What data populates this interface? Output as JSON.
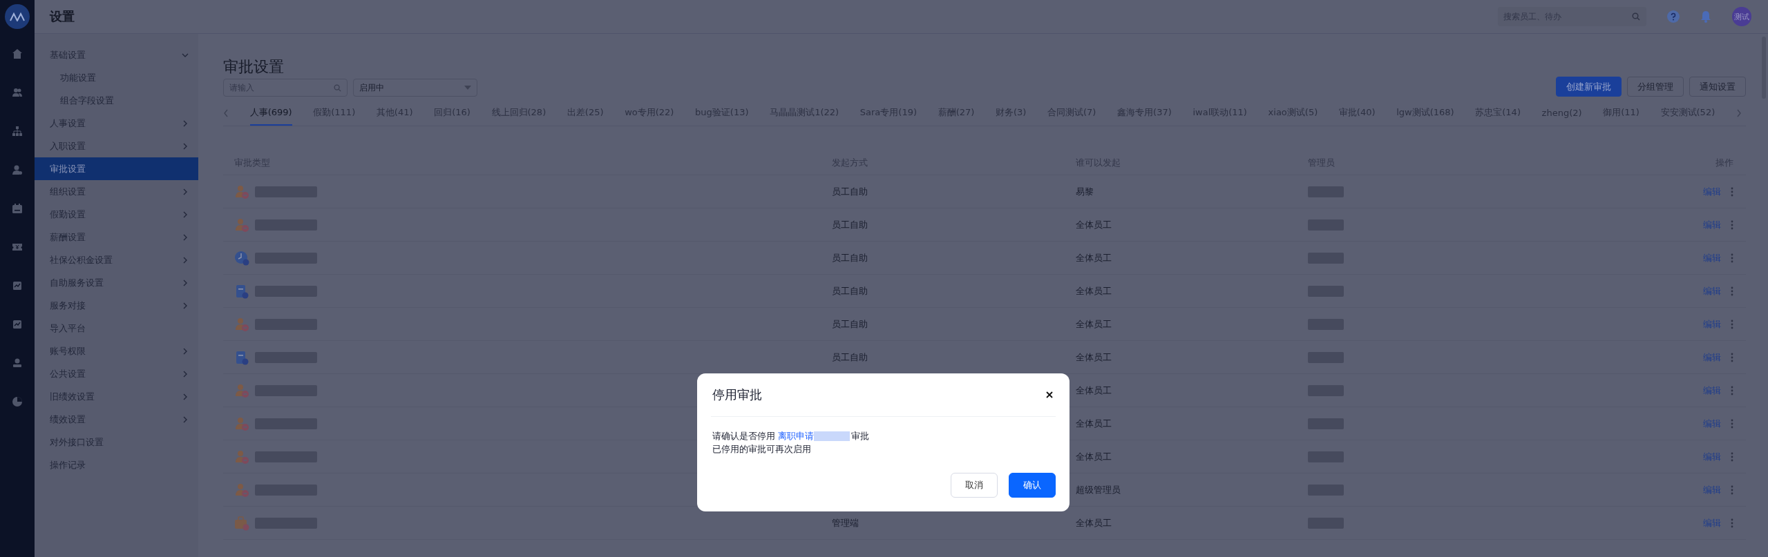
{
  "app": {
    "title": "设置"
  },
  "top_bar": {
    "search": {
      "placeholder": "搜索员工、待办"
    },
    "avatar": "测试"
  },
  "sidebar": {
    "items": [
      {
        "label": "基础设置",
        "expanded": true,
        "selected": false,
        "children": [
          {
            "label": "功能设置",
            "selected": false
          },
          {
            "label": "组合字段设置",
            "selected": false
          }
        ]
      },
      {
        "label": "人事设置",
        "expanded": false,
        "selected": false
      },
      {
        "label": "入职设置",
        "expanded": false,
        "selected": false
      },
      {
        "label": "审批设置",
        "selected": true
      },
      {
        "label": "组织设置",
        "expanded": false,
        "selected": false
      },
      {
        "label": "假勤设置",
        "expanded": false,
        "selected": false
      },
      {
        "label": "薪酬设置",
        "expanded": false,
        "selected": false
      },
      {
        "label": "社保公积金设置",
        "expanded": false,
        "selected": false
      },
      {
        "label": "自助服务设置",
        "expanded": false,
        "selected": false
      },
      {
        "label": "服务对接",
        "expanded": false,
        "selected": false
      },
      {
        "label": "导入平台",
        "selected": false
      },
      {
        "label": "账号权限",
        "expanded": false,
        "selected": false
      },
      {
        "label": "公共设置",
        "expanded": false,
        "selected": false
      },
      {
        "label": "旧绩效设置",
        "expanded": false,
        "selected": false
      },
      {
        "label": "绩效设置",
        "expanded": false,
        "selected": false
      },
      {
        "label": "对外接口设置",
        "selected": false
      },
      {
        "label": "操作记录",
        "selected": false
      }
    ]
  },
  "page": {
    "title": "审批设置",
    "search": {
      "placeholder": "请输入"
    },
    "status_select": {
      "value": "启用中"
    },
    "buttons": [
      {
        "label": "创建新审批",
        "kind": "primary"
      },
      {
        "label": "分组管理",
        "kind": "default"
      },
      {
        "label": "通知设置",
        "kind": "default"
      }
    ]
  },
  "tabs": [
    {
      "label": "人事(699)",
      "selected": true
    },
    {
      "label": "假勤(111)",
      "selected": false
    },
    {
      "label": "其他(41)",
      "selected": false
    },
    {
      "label": "回归(16)",
      "selected": false
    },
    {
      "label": "线上回归(28)",
      "selected": false
    },
    {
      "label": "出差(25)",
      "selected": false
    },
    {
      "label": "wo专用(22)",
      "selected": false
    },
    {
      "label": "bug验证(13)",
      "selected": false
    },
    {
      "label": "马晶晶测试1(22)",
      "selected": false
    },
    {
      "label": "Sara专用(19)",
      "selected": false
    },
    {
      "label": "薪酬(27)",
      "selected": false
    },
    {
      "label": "财务(3)",
      "selected": false
    },
    {
      "label": "合同测试(7)",
      "selected": false
    },
    {
      "label": "鑫海专用(37)",
      "selected": false
    },
    {
      "label": "iwal联动(11)",
      "selected": false
    },
    {
      "label": "xiao测试(5)",
      "selected": false
    },
    {
      "label": "审批(40)",
      "selected": false
    },
    {
      "label": "lgw测试(168)",
      "selected": false
    },
    {
      "label": "苏忠宝(14)",
      "selected": false
    },
    {
      "label": "zheng(2)",
      "selected": false
    },
    {
      "label": "御用(11)",
      "selected": false
    },
    {
      "label": "安安测试(52)",
      "selected": false
    }
  ],
  "table": {
    "columns": [
      "审批类型",
      "发起方式",
      "谁可以发起",
      "管理员",
      "操作"
    ],
    "rows": [
      {
        "kind": "person",
        "method": "员工自助",
        "who": "易黎",
        "action": "编辑"
      },
      {
        "kind": "person",
        "method": "员工自助",
        "who": "全体员工",
        "action": "编辑"
      },
      {
        "kind": "clock",
        "method": "员工自助",
        "who": "全体员工",
        "action": "编辑"
      },
      {
        "kind": "clipboard",
        "method": "员工自助",
        "who": "全体员工",
        "action": "编辑"
      },
      {
        "kind": "person",
        "method": "员工自助",
        "who": "全体员工",
        "action": "编辑"
      },
      {
        "kind": "clipboard",
        "method": "员工自助",
        "who": "全体员工",
        "action": "编辑"
      },
      {
        "kind": "person",
        "who": "全体员工",
        "action": "编辑"
      },
      {
        "kind": "person",
        "who": "全体员工",
        "action": "编辑"
      },
      {
        "kind": "person",
        "who": "全体员工",
        "action": "编辑"
      },
      {
        "kind": "person",
        "who": "超级管理员",
        "action": "编辑"
      },
      {
        "kind": "briefcase",
        "method": "管理端",
        "who": "全体员工",
        "action": "编辑"
      }
    ]
  },
  "dialog": {
    "title": "停用审批",
    "message_start": "请确认是否停用",
    "link": "离职申请",
    "message_end": "审批",
    "note": "已停用的审批可再次启用",
    "buttons": [
      {
        "label": "取消",
        "kind": "default"
      },
      {
        "label": "确认",
        "kind": "primary"
      }
    ]
  }
}
